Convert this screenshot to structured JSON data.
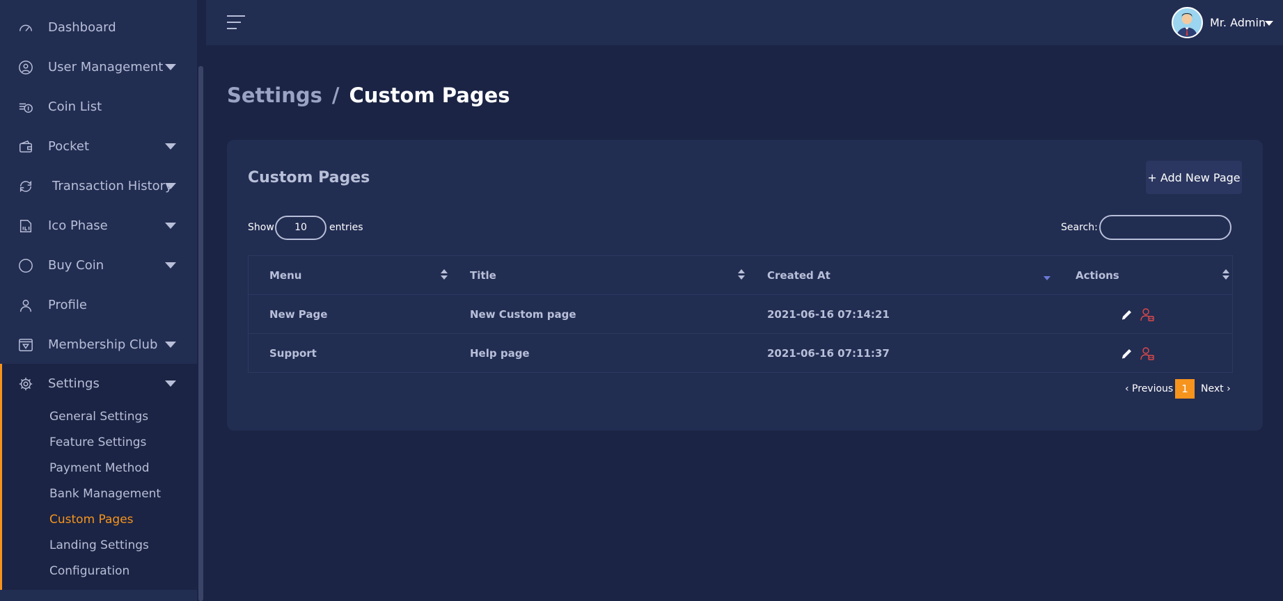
{
  "sidebar": {
    "items": [
      {
        "label": "Dashboard",
        "icon": "speedometer-icon"
      },
      {
        "label": "User Management",
        "icon": "user-circle-icon"
      },
      {
        "label": "Coin List",
        "icon": "coin-list-icon"
      },
      {
        "label": "Pocket",
        "icon": "wallet-icon"
      },
      {
        "label": "Transaction History",
        "icon": "exchange-icon"
      },
      {
        "label": "Ico Phase",
        "icon": "ico-icon"
      },
      {
        "label": "Buy Coin",
        "icon": "circle-icon"
      },
      {
        "label": "Profile",
        "icon": "person-icon"
      },
      {
        "label": "Membership Club",
        "icon": "diamond-icon"
      },
      {
        "label": "Settings",
        "icon": "gear-icon"
      }
    ],
    "settings_sub": [
      "General Settings",
      "Feature Settings",
      "Payment Method",
      "Bank Management",
      "Custom Pages",
      "Landing Settings",
      "Configuration"
    ],
    "active_sub": "Custom Pages"
  },
  "header": {
    "user_name": "Mr. Admin"
  },
  "breadcrumb": {
    "parent": "Settings",
    "separator": "/",
    "current": "Custom Pages"
  },
  "card": {
    "title": "Custom Pages",
    "add_button": "+ Add New Page",
    "show_label": "Show",
    "entries_value": "10",
    "entries_label": "entries",
    "search_label": "Search:",
    "search_value": ""
  },
  "table": {
    "columns": [
      "Menu",
      "Title",
      "Created At",
      "Actions"
    ],
    "rows": [
      {
        "menu": "New Page",
        "title": "New Custom page",
        "created_at": "2021-06-16 07:14:21"
      },
      {
        "menu": "Support",
        "title": "Help page",
        "created_at": "2021-06-16 07:11:37"
      }
    ]
  },
  "pagination": {
    "previous": "‹ Previous",
    "current_page": "1",
    "next": "Next ›"
  },
  "colors": {
    "accent": "#f7941d",
    "background": "#1b2444",
    "panel": "#222d52",
    "delete": "#e04a4a"
  }
}
